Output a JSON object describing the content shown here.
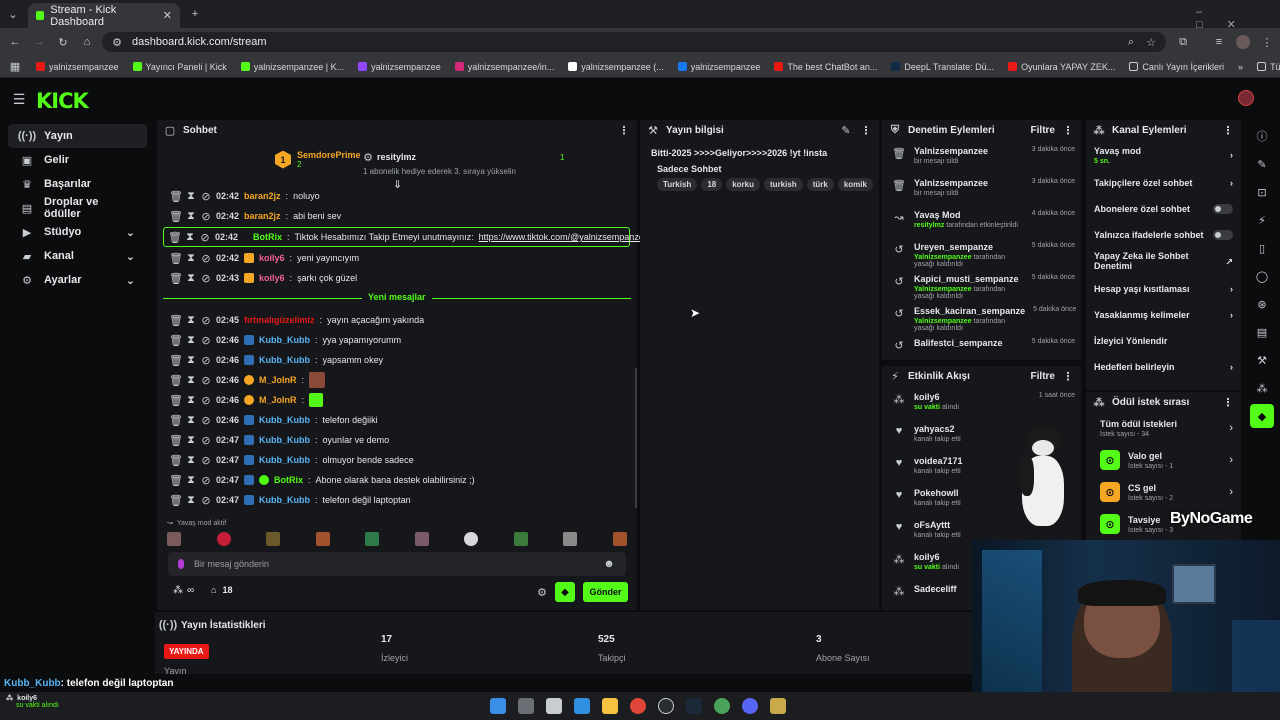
{
  "browser": {
    "tab_title": "Stream - Kick Dashboard",
    "url": "dashboard.kick.com/stream",
    "bookmarks": [
      "yalnizsempanzee",
      "Yayıncı Paneli | Kick",
      "yalnizsempanzee | K...",
      "yalnizsempanzee",
      "yalnizsempanzee/in...",
      "yalnizsempanzee (...",
      "yalnizsempanzee",
      "The best ChatBot an...",
      "DeepL Translate: Dü...",
      "Oyunlara YAPAY ZEK...",
      "Canlı Yayın İçerikleri"
    ],
    "bookmarks_right": "Tüm Yer İşaretleri"
  },
  "app": {
    "logo": "KICK"
  },
  "sidebar": {
    "items": [
      {
        "label": "Yayın",
        "active": true
      },
      {
        "label": "Gelir"
      },
      {
        "label": "Başarılar"
      },
      {
        "label": "Droplar ve ödüller"
      },
      {
        "label": "Stüdyo",
        "chevron": true
      },
      {
        "label": "Kanal",
        "chevron": true
      },
      {
        "label": "Ayarlar",
        "chevron": true
      }
    ]
  },
  "chat": {
    "title": "Sohbet",
    "gift": {
      "rank": "1",
      "user": "SemdorePrime",
      "count": "2",
      "recipient": "resitylmz",
      "sub_count": "1",
      "desc": "1 abonelik hediye ederek 3. sıraya yükselin"
    },
    "messages_top": [
      {
        "time": "02:42",
        "user": "baran2jz",
        "color": "#f5a623",
        "text": "noluyo"
      },
      {
        "time": "02:42",
        "user": "baran2jz",
        "color": "#f5a623",
        "text": "abi beni sev"
      },
      {
        "time": "02:42",
        "user": "BotRix",
        "color": "#53fc18",
        "text": "Tiktok Hesabımızı Takip Etmeyi unutmayınız:",
        "link": "https://www.tiktok.com/@yalnizsempanzee"
      },
      {
        "time": "02:42",
        "user": "koily6",
        "color": "#f06292",
        "text": "yeni yayıncıyım"
      },
      {
        "time": "02:43",
        "user": "koily6",
        "color": "#f06292",
        "text": "şarkı çok güzel"
      }
    ],
    "new_messages": "Yeni mesajlar",
    "messages_bottom": [
      {
        "time": "02:45",
        "user": "fırtınalıgüzelimiz",
        "color": "#e91916",
        "text": "yayın açacağım yakında"
      },
      {
        "time": "02:46",
        "user": "Kubb_Kubb",
        "color": "#5ab4f5",
        "text": "yya yapamıyorumm"
      },
      {
        "time": "02:46",
        "user": "Kubb_Kubb",
        "color": "#5ab4f5",
        "text": "yapsamm okey"
      },
      {
        "time": "02:46",
        "user": "M_JoInR",
        "color": "#f5a623",
        "text": ""
      },
      {
        "time": "02:46",
        "user": "M_JoInR",
        "color": "#f5a623",
        "text": ""
      },
      {
        "time": "02:46",
        "user": "Kubb_Kubb",
        "color": "#5ab4f5",
        "text": "telefon değiiki"
      },
      {
        "time": "02:47",
        "user": "Kubb_Kubb",
        "color": "#5ab4f5",
        "text": "oyunlar ve demo"
      },
      {
        "time": "02:47",
        "user": "Kubb_Kubb",
        "color": "#5ab4f5",
        "text": "olmuyor bende sadece"
      },
      {
        "time": "02:47",
        "user": "BotRix",
        "color": "#53fc18",
        "text": "Abone olarak bana destek olabilirsiniz ;)"
      },
      {
        "time": "02:47",
        "user": "Kubb_Kubb",
        "color": "#5ab4f5",
        "text": "telefon değil laptoptan"
      }
    ],
    "slow_mode": "Yavaş mod aktif",
    "input_placeholder": "Bir mesaj gönderin",
    "points_value": "∞",
    "viewers_value": "18",
    "send": "Gönder"
  },
  "stream_info": {
    "title": "Yayın bilgisi",
    "stream_title": "Bitti-2025 >>>>Geliyor>>>>2026 !yt !insta",
    "category": "Sadece Sohbet",
    "tags": [
      "Turkish",
      "18",
      "korku",
      "turkish",
      "türk",
      "komik"
    ]
  },
  "moderation": {
    "title": "Denetim Eylemleri",
    "filter": "Filtre",
    "items": [
      {
        "name": "Yalnizsempanzee",
        "desc": "bir mesajı sildi",
        "time": "3 dakika önce",
        "icon": "trash-icon"
      },
      {
        "name": "Yalnizsempanzee",
        "desc": "bir mesajı sildi",
        "time": "3 dakika önce",
        "icon": "trash-icon"
      },
      {
        "name": "Yavaş Mod",
        "actor": "resitylmz",
        "desc": "tarafından etkinleştirildi",
        "time": "4 dakika önce",
        "icon": "slow-icon"
      },
      {
        "name": "Ureyen_sempanze",
        "actor": "Yalnizsempanzee",
        "desc": "tarafından yasağı kaldırıldı",
        "time": "5 dakika önce",
        "icon": "undo-icon"
      },
      {
        "name": "Kapici_musti_sempanze",
        "actor": "Yalnizsempanzee",
        "desc": "tarafından yasağı kaldırıldı",
        "time": "5 dakika önce",
        "icon": "undo-icon"
      },
      {
        "name": "Essek_kaciran_sempanze",
        "actor": "Yalnizsempanzee",
        "desc": "tarafından yasağı kaldırıldı",
        "time": "5 dakika önce",
        "icon": "undo-icon"
      },
      {
        "name": "Balifestci_sempanze",
        "desc": "",
        "time": "5 dakika önce",
        "icon": "undo-icon"
      }
    ]
  },
  "activity": {
    "title": "Etkinlik Akışı",
    "filter": "Filtre",
    "items": [
      {
        "name": "koily6",
        "desc": "su vakti",
        "desc2": "alındı",
        "time": "1 saat önce",
        "icon": "points-icon"
      },
      {
        "name": "yahyacs2",
        "desc": "kanalı takip etti",
        "time": "",
        "icon": "heart-icon"
      },
      {
        "name": "voidea7171",
        "desc": "kanalı takip etti",
        "time": "",
        "icon": "heart-icon"
      },
      {
        "name": "Pokehowll",
        "desc": "kanalı takip etti",
        "time": "",
        "icon": "heart-icon"
      },
      {
        "name": "oFsAyttt",
        "desc": "kanalı takip etti",
        "time": "",
        "icon": "heart-icon"
      },
      {
        "name": "koily6",
        "desc": "su vakti",
        "desc2": "alındı",
        "time": "",
        "icon": "points-icon"
      },
      {
        "name": "Sadeceliff",
        "desc": "",
        "time": "",
        "icon": "points-icon"
      }
    ]
  },
  "channel": {
    "title": "Kanal Eylemleri",
    "items": [
      {
        "label": "Yavaş mod",
        "sub": "5 sn.",
        "control": "chevron"
      },
      {
        "label": "Takipçilere özel sohbet",
        "control": "chevron"
      },
      {
        "label": "Abonelere özel sohbet",
        "control": "toggle"
      },
      {
        "label": "Yalnızca ifadelerle sohbet",
        "control": "toggle"
      },
      {
        "label": "Yapay Zeka ile Sohbet Denetimi",
        "control": "external"
      },
      {
        "label": "Hesap yaşı kısıtlaması",
        "control": "chevron"
      },
      {
        "label": "Yasaklanmış kelimeler",
        "control": "chevron"
      },
      {
        "label": "İzleyici Yönlendir",
        "control": "none"
      },
      {
        "label": "Hedefleri belirleyin",
        "control": "chevron"
      }
    ]
  },
  "rewards": {
    "title": "Ödül istek sırası",
    "all": "Tüm ödül istekleri",
    "all_sub": "İstek sayısı - 34",
    "items": [
      {
        "label": "Valo gel",
        "sub": "İstek sayısı - 1",
        "color": "#53fc18"
      },
      {
        "label": "CS gel",
        "sub": "İstek sayısı - 2",
        "color": "#f5a623"
      },
      {
        "label": "Tavsiye",
        "sub": "İstek sayısı - 3",
        "color": "#53fc18"
      }
    ]
  },
  "stats": {
    "title": "Yayın İstatistikleri",
    "live_badge": "YAYINDA",
    "items": [
      {
        "value": "",
        "label": "Yayın"
      },
      {
        "value": "17",
        "label": "İzleyici"
      },
      {
        "value": "525",
        "label": "Takipçi"
      },
      {
        "value": "3",
        "label": "Abone Sayısı"
      }
    ]
  },
  "overlay": {
    "brand": "ByNoGame",
    "ticker_user": "Kubb_Kubb",
    "ticker_text": ": telefon değil laptoptan",
    "corner_user": "koily6",
    "corner_desc": "su vakti alındı"
  }
}
